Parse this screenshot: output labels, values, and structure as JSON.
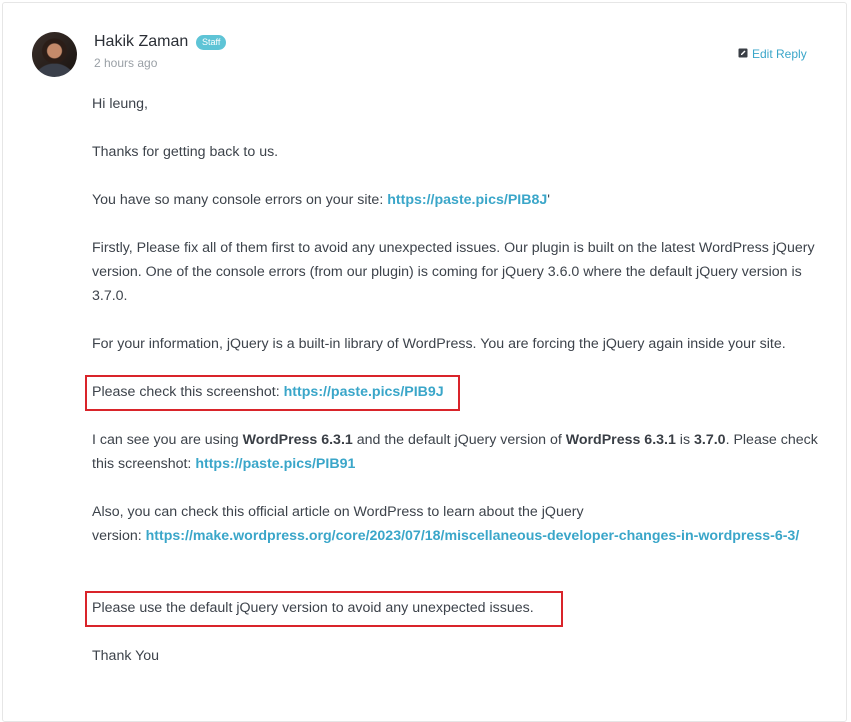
{
  "reply": {
    "author": "Hakik Zaman",
    "badge": "Staff",
    "time": "2 hours ago",
    "edit_label": "Edit Reply"
  },
  "message": {
    "greeting": "Hi leung,",
    "thanks": "Thanks for getting back to us.",
    "console_text": "You have so many console errors on your site: ",
    "console_link": "https://paste.pics/PIB8J",
    "console_tail": "'",
    "firstly": "Firstly, Please fix all of them first to avoid any unexpected issues. Our plugin is built on the latest WordPress jQuery version. One of the console errors (from our plugin) is coming for jQuery 3.6.0 where the default jQuery version is 3.7.0.",
    "info": "For your information, jQuery is a built-in library of WordPress. You are forcing the jQuery again inside your site.",
    "check_text": "Please check this screenshot: ",
    "check_link": "https://paste.pics/PIB9J",
    "using_1": "I can see you are using ",
    "using_b1": "WordPress 6.3.1",
    "using_2": " and the default jQuery version of ",
    "using_b2": "WordPress 6.3.1",
    "using_3": " is ",
    "using_b3": "3.7.0",
    "using_4": ". Please check this screenshot: ",
    "using_link": "https://paste.pics/PIB91",
    "article_text": "Also, you can check this official article on WordPress to learn about the jQuery version: ",
    "article_link": "https://make.wordpress.org/core/2023/07/18/miscellaneous-developer-changes-in-wordpress-6-3/",
    "default_use": "Please use the default jQuery version to avoid any unexpected issues.",
    "signoff": "Thank You"
  },
  "colors": {
    "link": "#3aa6c9",
    "badge": "#5ec4d6",
    "highlight": "#d9242a"
  }
}
